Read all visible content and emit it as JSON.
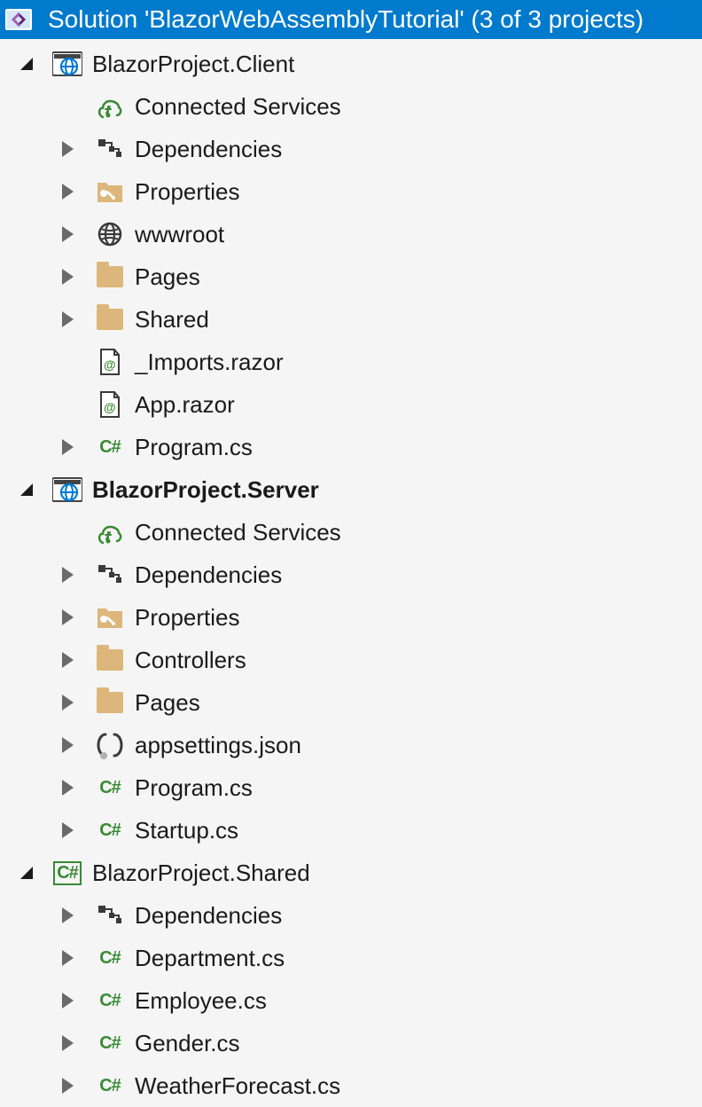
{
  "header": {
    "title": "Solution 'BlazorWebAssemblyTutorial' (3 of 3 projects)"
  },
  "projects": [
    {
      "name": "BlazorProject.Client",
      "bold": false,
      "icon": "web-project",
      "expanded": true,
      "children": [
        {
          "name": "Connected Services",
          "icon": "connected-services",
          "expander": "none"
        },
        {
          "name": "Dependencies",
          "icon": "dependencies",
          "expander": "collapsed"
        },
        {
          "name": "Properties",
          "icon": "folder-wrench",
          "expander": "collapsed"
        },
        {
          "name": "wwwroot",
          "icon": "globe",
          "expander": "collapsed"
        },
        {
          "name": "Pages",
          "icon": "folder",
          "expander": "collapsed"
        },
        {
          "name": "Shared",
          "icon": "folder",
          "expander": "collapsed"
        },
        {
          "name": "_Imports.razor",
          "icon": "razor-file",
          "expander": "none"
        },
        {
          "name": "App.razor",
          "icon": "razor-file",
          "expander": "none"
        },
        {
          "name": "Program.cs",
          "icon": "csharp-file",
          "expander": "collapsed"
        }
      ]
    },
    {
      "name": "BlazorProject.Server",
      "bold": true,
      "icon": "web-project",
      "expanded": true,
      "children": [
        {
          "name": "Connected Services",
          "icon": "connected-services",
          "expander": "none"
        },
        {
          "name": "Dependencies",
          "icon": "dependencies",
          "expander": "collapsed"
        },
        {
          "name": "Properties",
          "icon": "folder-wrench",
          "expander": "collapsed"
        },
        {
          "name": "Controllers",
          "icon": "folder",
          "expander": "collapsed"
        },
        {
          "name": "Pages",
          "icon": "folder",
          "expander": "collapsed"
        },
        {
          "name": "appsettings.json",
          "icon": "json-file",
          "expander": "collapsed"
        },
        {
          "name": "Program.cs",
          "icon": "csharp-file",
          "expander": "collapsed"
        },
        {
          "name": "Startup.cs",
          "icon": "csharp-file",
          "expander": "collapsed"
        }
      ]
    },
    {
      "name": "BlazorProject.Shared",
      "bold": false,
      "icon": "csharp-project",
      "expanded": true,
      "children": [
        {
          "name": "Dependencies",
          "icon": "dependencies",
          "expander": "collapsed"
        },
        {
          "name": "Department.cs",
          "icon": "csharp-file",
          "expander": "collapsed"
        },
        {
          "name": "Employee.cs",
          "icon": "csharp-file",
          "expander": "collapsed"
        },
        {
          "name": "Gender.cs",
          "icon": "csharp-file",
          "expander": "collapsed"
        },
        {
          "name": "WeatherForecast.cs",
          "icon": "csharp-file",
          "expander": "collapsed"
        }
      ]
    }
  ]
}
